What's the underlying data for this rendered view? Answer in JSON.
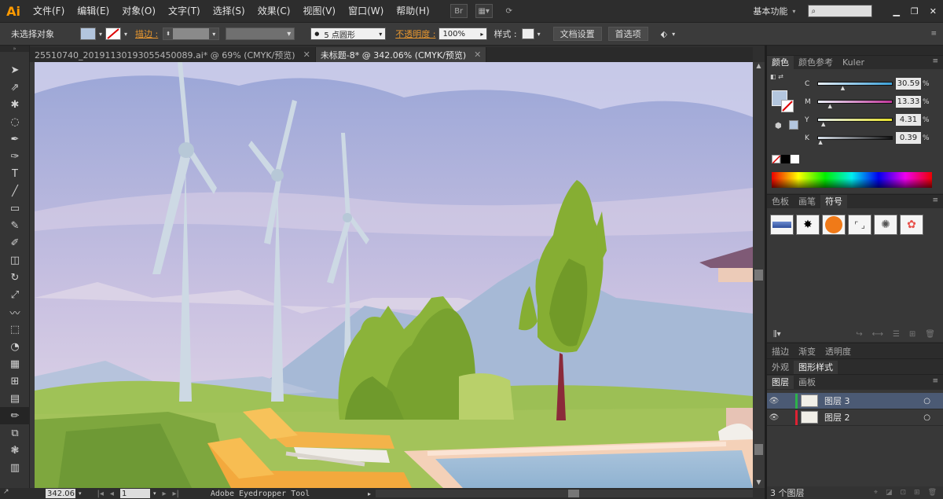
{
  "app": {
    "logo": "Ai"
  },
  "menu": [
    "文件(F)",
    "编辑(E)",
    "对象(O)",
    "文字(T)",
    "选择(S)",
    "效果(C)",
    "视图(V)",
    "窗口(W)",
    "帮助(H)"
  ],
  "menubar_right": {
    "workspace": "基本功能",
    "search_placeholder": ""
  },
  "menubar_icons": [
    "br-icon",
    "layout-icon",
    "sync-icon"
  ],
  "control": {
    "selection": "未选择对象",
    "stroke_label": "描边 :",
    "brush": "5 点圆形",
    "opacity_label": "不透明度 :",
    "opacity_value": "100%",
    "style_label": "样式 :",
    "doc_setup": "文档设置",
    "preferences": "首选项"
  },
  "tabs": [
    {
      "label": "25510740_20191130193055450089.ai* @ 69% (CMYK/预览)",
      "active": false
    },
    {
      "label": "未标题-8* @ 342.06% (CMYK/预览)",
      "active": true
    }
  ],
  "tools": [
    "selection-tool",
    "direct-selection-tool",
    "magic-wand-tool",
    "lasso-tool",
    "pen-tool",
    "curvature-tool",
    "type-tool",
    "line-tool",
    "rectangle-tool",
    "paintbrush-tool",
    "pencil-tool",
    "eraser-tool",
    "rotate-tool",
    "scale-tool",
    "warp-tool",
    "free-transform-tool",
    "shape-builder-tool",
    "perspective-tool",
    "mesh-tool",
    "gradient-tool",
    "eyedropper-tool",
    "blend-tool",
    "symbol-sprayer-tool",
    "column-graph-tool"
  ],
  "tool_glyphs": [
    "➤",
    "⇗",
    "✱",
    "◌",
    "✒",
    "✑",
    "T",
    "╱",
    "▭",
    "✎",
    "✐",
    "◫",
    "↻",
    "⤢",
    "〰",
    "⬚",
    "◔",
    "▦",
    "⊞",
    "▤",
    "✏",
    "⧉",
    "❃",
    "▥"
  ],
  "status": {
    "zoom": "342.06",
    "page": "1",
    "tool": "Adobe Eyedropper Tool"
  },
  "color_panel": {
    "tabs": [
      "颜色",
      "颜色参考",
      "Kuler"
    ],
    "channels": [
      {
        "name": "C",
        "value": "30.59",
        "percent": 30.59
      },
      {
        "name": "M",
        "value": "13.33",
        "percent": 13.33
      },
      {
        "name": "Y",
        "value": "4.31",
        "percent": 4.31
      },
      {
        "name": "K",
        "value": "0.39",
        "percent": 0.39
      }
    ],
    "unit": "%",
    "fill_color": "#b3c6de"
  },
  "swatch_panel": {
    "tabs": [
      "色板",
      "画笔",
      "符号"
    ],
    "symbols": [
      "blue-banner-symbol",
      "ink-splat-symbol",
      "orange-button-symbol",
      "frame-symbol",
      "ring-symbol",
      "flower-symbol"
    ]
  },
  "stroke_panel": {
    "tabs": [
      "描边",
      "渐变",
      "透明度"
    ]
  },
  "appearance_panel": {
    "tabs": [
      "外观",
      "图形样式"
    ]
  },
  "layers_panel": {
    "tabs": [
      "图层",
      "画板"
    ],
    "layers": [
      {
        "name": "图层 3"
      },
      {
        "name": "图层 2"
      }
    ],
    "footer": "3 个图层"
  },
  "colors": {
    "accent": "#ff9a00",
    "stroke_label": "#e8972f",
    "selected_layer": "#4b5a74"
  }
}
